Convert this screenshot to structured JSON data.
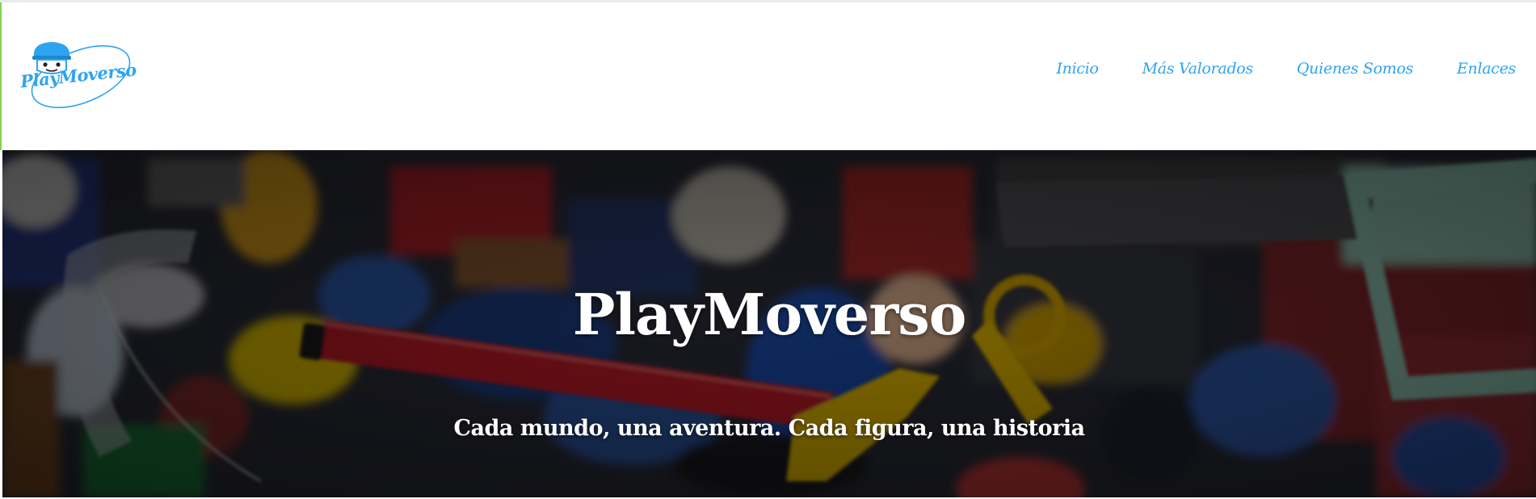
{
  "brand": {
    "logo_text": "PlayMoverso",
    "logo_icon": "playmobil-head-icon",
    "color": "#2ea3f2"
  },
  "nav": {
    "items": [
      {
        "label": "Inicio"
      },
      {
        "label": "Más Valorados"
      },
      {
        "label": "Quienes Somos"
      },
      {
        "label": "Enlaces"
      }
    ]
  },
  "hero": {
    "title": "PlayMoverso",
    "subtitle": "Cada mundo, una aventura. Cada figura, una historia",
    "background": "pile-of-playmobil-toys-photo"
  }
}
